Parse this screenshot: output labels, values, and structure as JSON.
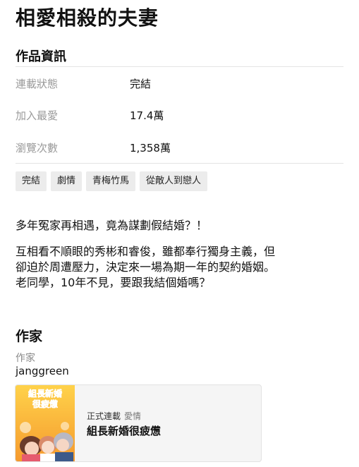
{
  "title": "相愛相殺的夫妻",
  "info_section": {
    "heading": "作品資訊",
    "rows": [
      {
        "label": "連載狀態",
        "value": "完結"
      },
      {
        "label": "加入最愛",
        "value": "17.4萬"
      },
      {
        "label": "瀏覽次數",
        "value": "1,358萬"
      }
    ],
    "tags": [
      "完結",
      "劇情",
      "青梅竹馬",
      "從敵人到戀人"
    ]
  },
  "synopsis": {
    "headline": "多年冤家再相遇，竟為謀劃假結婚？！",
    "line1": "互相看不順眼的秀彬和睿俊，雖都奉行獨身主義，但",
    "line2": "卻迫於周遭壓力，決定來一場為期一年的契約婚姻。",
    "line3": "老同學，10年不見，要跟我結個婚嗎？"
  },
  "author_section": {
    "heading": "作家",
    "role": "作家",
    "name": "janggreen"
  },
  "related_work": {
    "status": "正式連載",
    "genre": "愛情",
    "title": "組長新婚很疲憊",
    "thumbnail_text_line1": "組長新婚",
    "thumbnail_text_line2": "很疲憊"
  }
}
